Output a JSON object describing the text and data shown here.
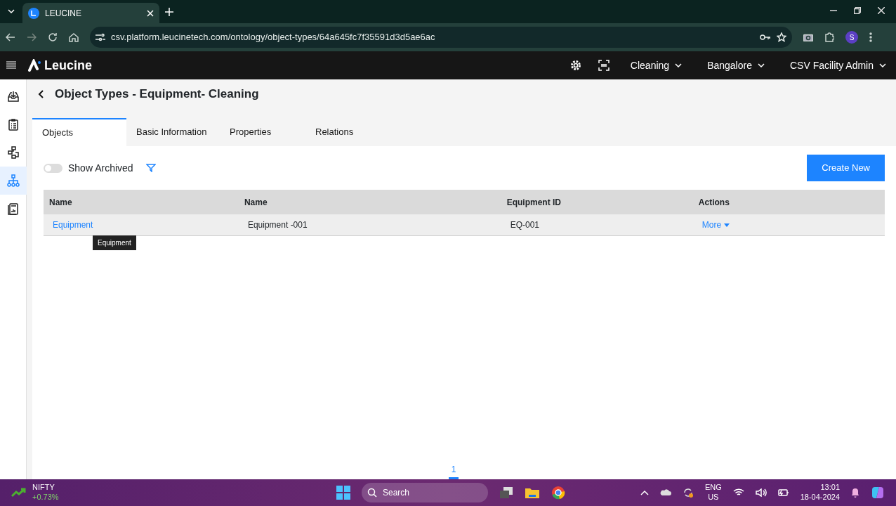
{
  "browser": {
    "tab_title": "LEUCINE",
    "url": "csv.platform.leucinetech.com/ontology/object-types/64a645fc7f35591d3d5ae6ac",
    "profile_initial": "S"
  },
  "navbar": {
    "brand": "Leucine",
    "dropdowns": [
      "Cleaning",
      "Bangalore",
      "CSV Facility Admin"
    ]
  },
  "sidebar": {
    "items": [
      {
        "selected": false
      },
      {
        "selected": false
      },
      {
        "selected": false
      },
      {
        "selected": true
      },
      {
        "selected": false
      }
    ]
  },
  "page": {
    "title": "Object Types - Equipment- Cleaning"
  },
  "tabs": [
    {
      "label": "Objects",
      "selected": true
    },
    {
      "label": "Basic Information",
      "selected": false
    },
    {
      "label": "Properties",
      "selected": false
    },
    {
      "label": "Relations",
      "selected": false
    }
  ],
  "toolbar": {
    "toggle_label": "Show Archived",
    "show_archived": false,
    "create_button": "Create New"
  },
  "table": {
    "columns": [
      "Name",
      "Name",
      "Equipment ID",
      "Actions"
    ],
    "rows": [
      {
        "cells": [
          "Equipment",
          "Equipment -001",
          "EQ-001",
          "More"
        ]
      }
    ]
  },
  "tooltip": "Equipment",
  "pagination": [
    {
      "label": "1",
      "selected": true
    }
  ],
  "taskbar": {
    "ticker_name": "NIFTY",
    "ticker_change": "+0.73%",
    "search_placeholder": "Search",
    "lang": "ENG",
    "region": "US",
    "time": "13:01",
    "date": "18-04-2024"
  }
}
